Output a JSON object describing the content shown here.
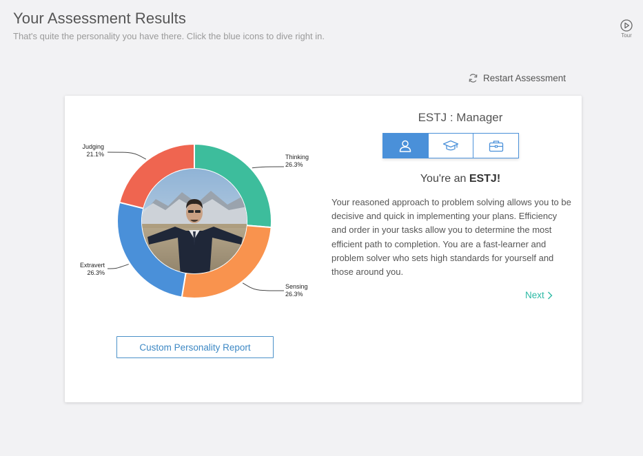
{
  "header": {
    "title": "Your Assessment Results",
    "subtitle": "That's quite the personality you have there. Click the blue icons to dive right in.",
    "tour_label": "Tour"
  },
  "restart_label": "Restart Assessment",
  "chart_data": {
    "type": "pie",
    "donut": true,
    "center_image": "portrait-photo",
    "categories": [
      "Thinking",
      "Sensing",
      "Extravert",
      "Judging"
    ],
    "values": [
      26.3,
      26.3,
      26.3,
      21.1
    ],
    "value_labels": [
      "26.3%",
      "26.3%",
      "26.3%",
      "21.1%"
    ],
    "colors": [
      "#3dbd9c",
      "#f9934e",
      "#4a90d9",
      "#ef6550"
    ]
  },
  "report_button_label": "Custom Personality Report",
  "result": {
    "type_title": "ESTJ : Manager",
    "tabs": [
      {
        "icon": "user-icon",
        "active": true
      },
      {
        "icon": "graduation-cap-icon",
        "active": false
      },
      {
        "icon": "briefcase-icon",
        "active": false
      }
    ],
    "headline_prefix": "You're an ",
    "headline_type": "ESTJ!",
    "description": "Your reasoned approach to problem solving allows you to be decisive and quick in implementing your plans. Efficiency and order in your tasks allow you to determine the most efficient path to completion. You are a fast-learner and problem solver who sets high standards for yourself and those around you.",
    "next_label": "Next"
  },
  "colors": {
    "accent_blue": "#4a90d9",
    "accent_teal": "#2bb9a4"
  }
}
